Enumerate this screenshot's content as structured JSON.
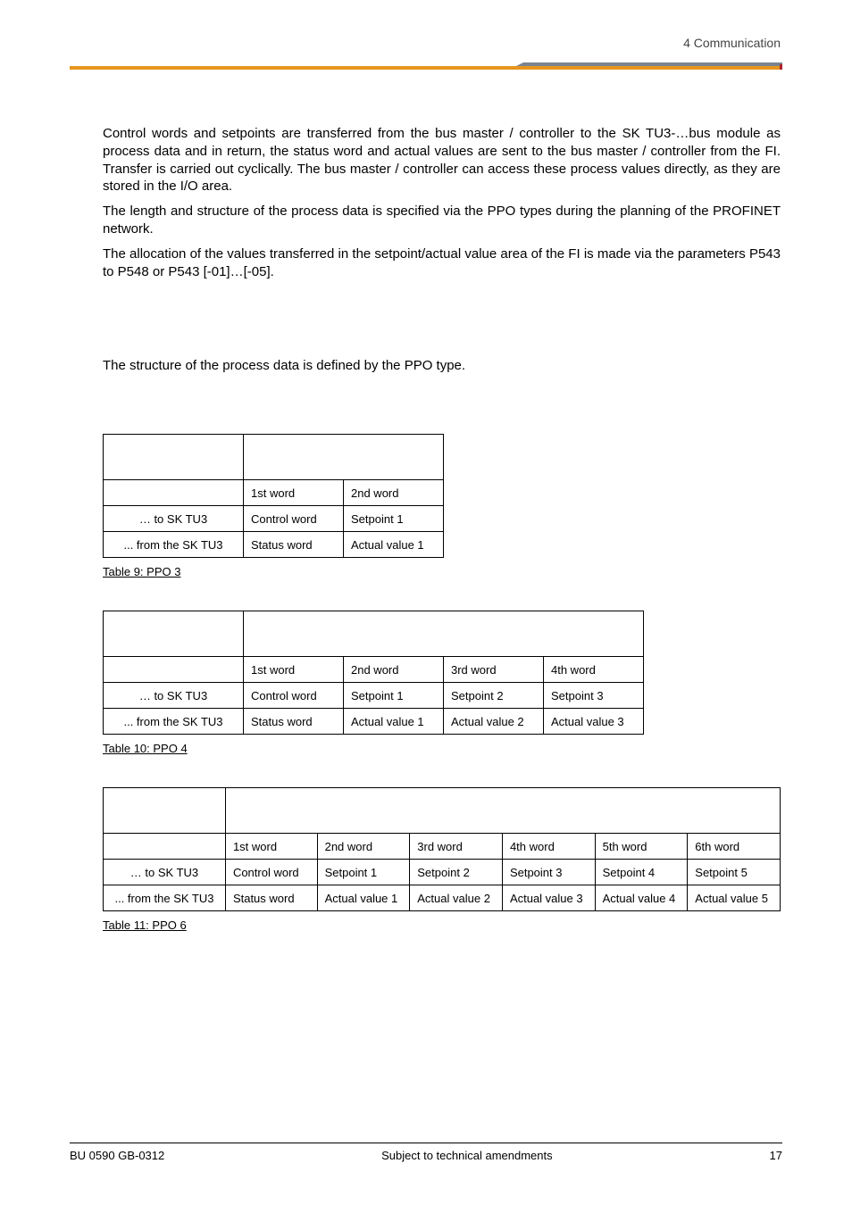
{
  "header": {
    "section": "4   Communication"
  },
  "body": {
    "p1": "Control words and setpoints are transferred from the bus master / controller to the SK TU3-…bus module as process data and in return, the status word and actual values are sent to the bus master / controller from the FI. Transfer is carried out cyclically. The bus master / controller can access these process values directly, as they are stored in the I/O area.",
    "p2": "The length and structure of the process data is specified via the PPO types during the planning of the PROFINET network.",
    "p3": "The allocation of the values transferred in the setpoint/actual value area of the FI is made via the parameters P543 to P548 or P543 [-01]…[-05].",
    "p4": "The structure of the process data is defined by the PPO type."
  },
  "rows": {
    "to": "… to SK TU3",
    "from": "... from the SK TU3"
  },
  "words": {
    "w1": "1st word",
    "w2": "2nd word",
    "w3": "3rd word",
    "w4": "4th word",
    "w5": "5th word",
    "w6": "6th word"
  },
  "cells": {
    "cw": "Control word",
    "sw": "Status word",
    "sp1": "Setpoint 1",
    "sp2": "Setpoint 2",
    "sp3": "Setpoint 3",
    "sp4": "Setpoint 4",
    "sp5": "Setpoint 5",
    "av1": "Actual value 1",
    "av2": "Actual value 2",
    "av3": "Actual value 3",
    "av4": "Actual value 4",
    "av5": "Actual value 5"
  },
  "captions": {
    "t9": "Table 9: PPO 3",
    "t10": "Table 10: PPO 4",
    "t11": "Table 11: PPO 6"
  },
  "footer": {
    "left": "BU 0590 GB-0312",
    "center": "Subject to technical amendments",
    "right": "17"
  }
}
